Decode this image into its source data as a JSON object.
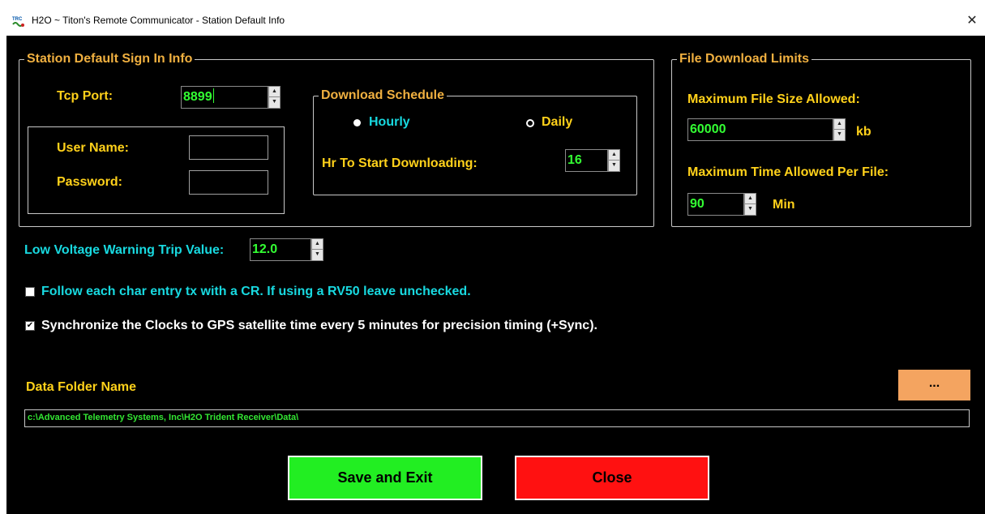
{
  "window": {
    "title": "H2O ~ Titon's Remote Communicator - Station Default Info",
    "app_icon": "trc-app-icon",
    "close_glyph": "✕"
  },
  "sign_in": {
    "legend": "Station Default Sign In Info",
    "tcp_port_label": "Tcp Port:",
    "tcp_port_value": "8899",
    "user_name_label": "User Name:",
    "user_name_value": "",
    "password_label": "Password:",
    "password_value": ""
  },
  "schedule": {
    "legend": "Download Schedule",
    "hourly_label": "Hourly",
    "daily_label": "Daily",
    "selected": "hourly",
    "hr_start_label": "Hr To Start Downloading:",
    "hr_start_value": "16"
  },
  "limits": {
    "legend": "File Download Limits",
    "max_size_label": "Maximum File Size Allowed:",
    "max_size_value": "60000",
    "max_size_unit": "kb",
    "max_time_label": "Maximum Time Allowed Per File:",
    "max_time_value": "90",
    "max_time_unit": "Min"
  },
  "voltage": {
    "label": "Low Voltage Warning Trip Value:",
    "value": "12.0"
  },
  "options": {
    "cr_label": "Follow each char entry tx with a CR. If using a RV50 leave unchecked.",
    "cr_checked": false,
    "sync_label": "Synchronize the Clocks to GPS satellite time every 5 minutes for precision timing (+Sync).",
    "sync_checked": true
  },
  "data_folder": {
    "label": "Data Folder Name",
    "browse_label": "...",
    "path": "c:\\Advanced Telemetry Systems, Inc\\H2O Trident Receiver\\Data\\"
  },
  "buttons": {
    "save_label": "Save and Exit",
    "close_label": "Close"
  },
  "colors": {
    "legend": "#f0b040",
    "label_yellow": "#ffd11a",
    "label_cyan": "#18d9e0",
    "value_green": "#33ff33",
    "save_bg": "#22ee22",
    "close_bg": "#ff1111",
    "browse_bg": "#f4a460"
  },
  "icons": {
    "spin_up": "▲",
    "spin_down": "▼",
    "check": "✔"
  }
}
